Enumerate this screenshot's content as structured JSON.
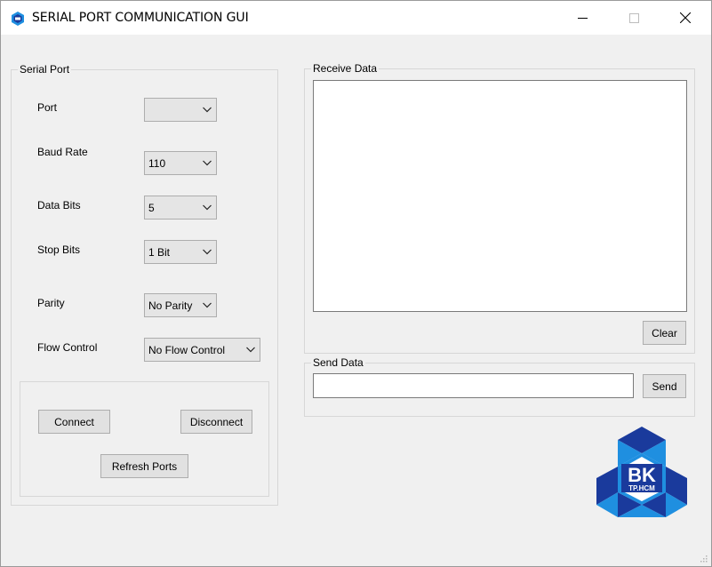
{
  "window": {
    "title": "SERIAL PORT COMMUNICATION GUI",
    "icon": "app-logo-icon",
    "controls": [
      "minimize-icon",
      "maximize-icon",
      "close-icon"
    ]
  },
  "serial_port": {
    "group_title": "Serial Port",
    "port": {
      "label": "Port",
      "value": ""
    },
    "baud_rate": {
      "label": "Baud Rate",
      "value": "110"
    },
    "data_bits": {
      "label": "Data Bits",
      "value": "5"
    },
    "stop_bits": {
      "label": "Stop Bits",
      "value": "1 Bit"
    },
    "parity": {
      "label": "Parity",
      "value": "No Parity"
    },
    "flow_control": {
      "label": "Flow Control",
      "value": "No Flow Control"
    },
    "buttons": {
      "connect": "Connect",
      "disconnect": "Disconnect",
      "refresh": "Refresh Ports"
    }
  },
  "receive": {
    "group_title": "Receive Data",
    "content": "",
    "clear_label": "Clear"
  },
  "send": {
    "group_title": "Send Data",
    "value": "",
    "send_label": "Send"
  },
  "logo": {
    "text_main": "BK",
    "text_sub": "TP.HCM",
    "colors": {
      "dark": "#1a3a9c",
      "light": "#1f8fe0"
    }
  }
}
